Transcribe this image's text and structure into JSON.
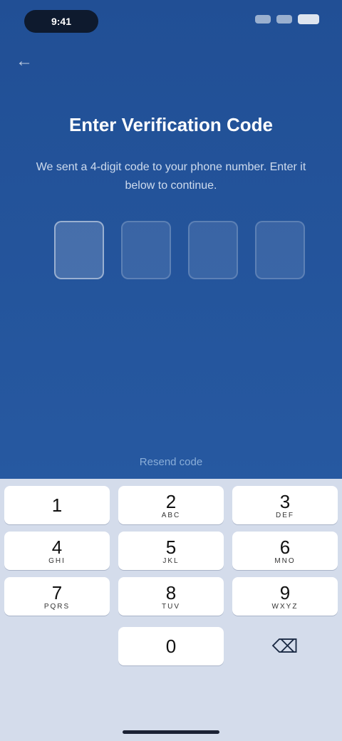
{
  "status_bar": {
    "time": "9:41",
    "icons": [
      "signal-icon",
      "wifi-icon",
      "battery-icon"
    ]
  },
  "nav": {
    "back_icon": "back-arrow-icon",
    "back_glyph": "←"
  },
  "header": {
    "title": "Enter Verification Code",
    "subtitle": "We sent a 4-digit code to your phone number. Enter it below to continue."
  },
  "code": {
    "length": 4,
    "digits": [
      "",
      "",
      "",
      ""
    ]
  },
  "resend": {
    "label": "Resend code"
  },
  "keyboard": {
    "rows": [
      [
        {
          "digit": "1",
          "letters": ""
        },
        {
          "digit": "2",
          "letters": "ABC"
        },
        {
          "digit": "3",
          "letters": "DEF"
        }
      ],
      [
        {
          "digit": "4",
          "letters": "GHI"
        },
        {
          "digit": "5",
          "letters": "JKL"
        },
        {
          "digit": "6",
          "letters": "MNO"
        }
      ],
      [
        {
          "digit": "7",
          "letters": "PQRS"
        },
        {
          "digit": "8",
          "letters": "TUV"
        },
        {
          "digit": "9",
          "letters": "WXYZ"
        }
      ],
      [
        {
          "digit": "",
          "letters": ""
        },
        {
          "digit": "0",
          "letters": ""
        },
        {
          "digit": "⌫",
          "letters": ""
        }
      ]
    ]
  },
  "colors": {
    "background": "#2658a0",
    "keyboard": "#d4dceb",
    "key": "#ffffff"
  }
}
